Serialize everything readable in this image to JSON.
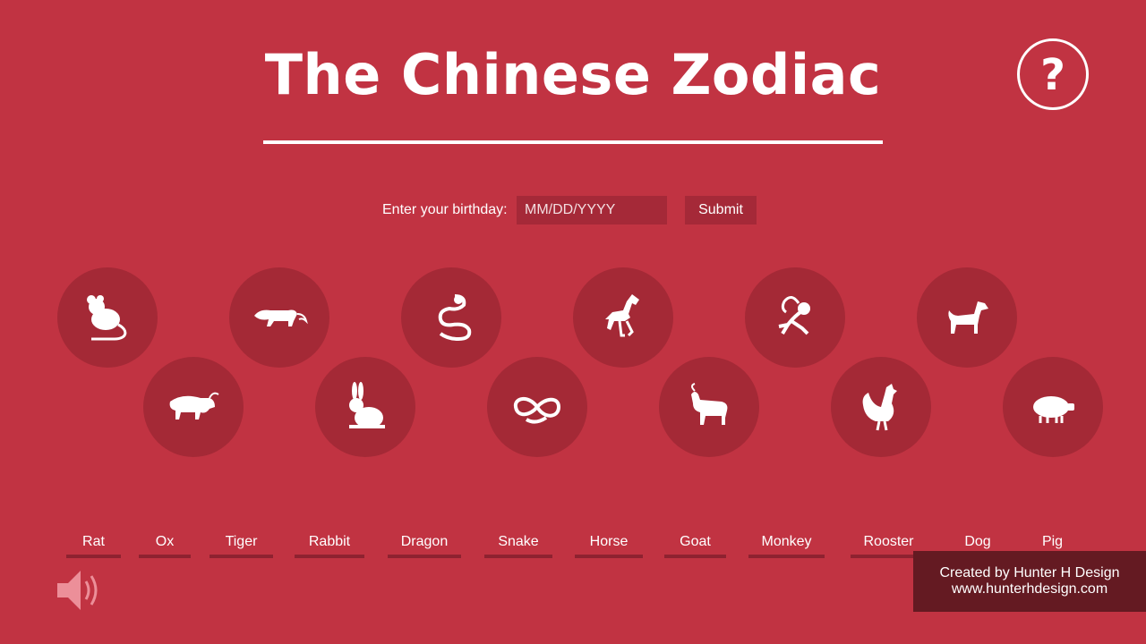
{
  "header": {
    "title": "The Chinese Zodiac",
    "help_label": "?"
  },
  "form": {
    "label": "Enter your birthday:",
    "placeholder": "MM/DD/YYYY",
    "value": "",
    "submit_label": "Submit"
  },
  "animals": [
    {
      "label": "Rat",
      "icon": "rat-icon"
    },
    {
      "label": "Ox",
      "icon": "ox-icon"
    },
    {
      "label": "Tiger",
      "icon": "tiger-icon"
    },
    {
      "label": "Rabbit",
      "icon": "rabbit-icon"
    },
    {
      "label": "Dragon",
      "icon": "dragon-icon"
    },
    {
      "label": "Snake",
      "icon": "snake-icon"
    },
    {
      "label": "Horse",
      "icon": "horse-icon"
    },
    {
      "label": "Goat",
      "icon": "goat-icon"
    },
    {
      "label": "Monkey",
      "icon": "monkey-icon"
    },
    {
      "label": "Rooster",
      "icon": "rooster-icon"
    },
    {
      "label": "Dog",
      "icon": "dog-icon"
    },
    {
      "label": "Pig",
      "icon": "pig-icon"
    }
  ],
  "footer": {
    "credit_line1": "Created by Hunter H Design",
    "credit_line2": "www.hunterhdesign.com"
  },
  "colors": {
    "background": "#c13342",
    "circle": "#a42936",
    "input": "#a52938",
    "underline": "#8e2230",
    "credit_bg": "#641a22",
    "foreground": "#ffffff"
  }
}
